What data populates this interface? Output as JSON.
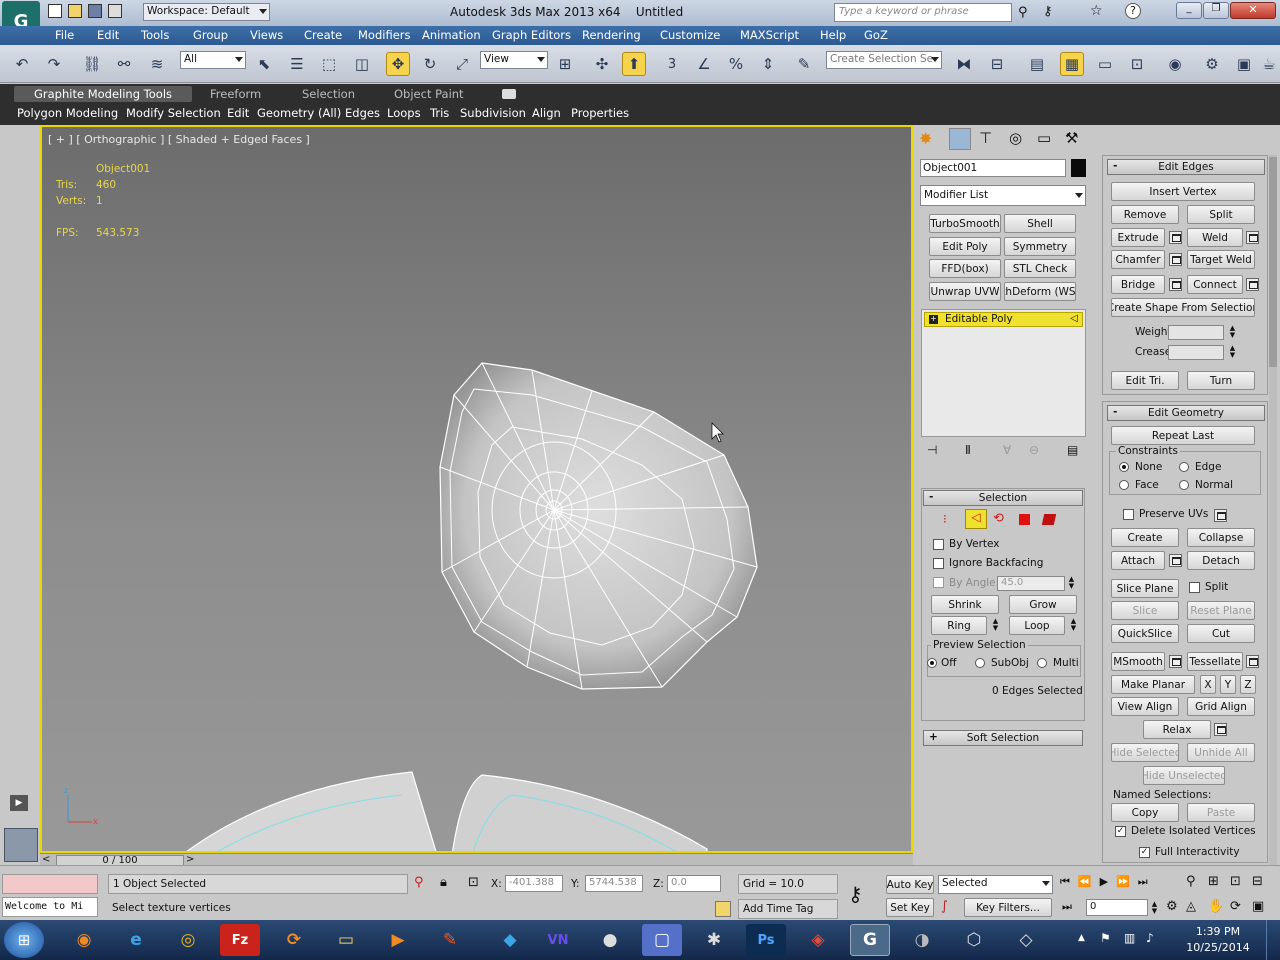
{
  "title": {
    "app": "Autodesk 3ds Max 2013 x64",
    "file": "Untitled",
    "workspace": "Workspace: Default",
    "search_placeholder": "Type a keyword or phrase"
  },
  "menu": [
    "File",
    "Edit",
    "Tools",
    "Group",
    "Views",
    "Create",
    "Modifiers",
    "Animation",
    "Graph Editors",
    "Rendering",
    "Customize",
    "MAXScript",
    "Help",
    "GoZ"
  ],
  "toolbar": {
    "filter": "All",
    "ref_coord": "View",
    "snap_label": "3",
    "selection_set_placeholder": "Create Selection Se"
  },
  "ribbon": {
    "tabs": [
      "Graphite Modeling Tools",
      "Freeform",
      "Selection",
      "Object Paint"
    ],
    "subtabs": [
      "Polygon Modeling",
      "Modify Selection",
      "Edit",
      "Geometry (All)",
      "Edges",
      "Loops",
      "Tris",
      "Subdivision",
      "Align",
      "Properties"
    ]
  },
  "viewport": {
    "label": "[ + ] [ Orthographic ] [ Shaded + Edged Faces ]",
    "object": "Object001",
    "tris_label": "Tris:",
    "tris": "460",
    "verts_label": "Verts:",
    "verts": "1",
    "fps_label": "FPS:",
    "fps": "543.573"
  },
  "modify": {
    "object_name": "Object001",
    "modifier_list": "Modifier List",
    "modifier_buttons": [
      "TurboSmooth",
      "Shell",
      "Edit Poly",
      "Symmetry",
      "FFD(box)",
      "STL Check",
      "Unwrap UVW",
      "thDeform (WSI"
    ],
    "stack_item": "Editable Poly",
    "selection": {
      "header": "Selection",
      "by_vertex": "By Vertex",
      "ignore_backfacing": "Ignore Backfacing",
      "by_angle": "By Angle:",
      "angle_value": "45.0",
      "shrink": "Shrink",
      "grow": "Grow",
      "ring": "Ring",
      "loop": "Loop",
      "preview_label": "Preview Selection",
      "preview_off": "Off",
      "preview_subobj": "SubObj",
      "preview_multi": "Multi",
      "selected_count": "0 Edges Selected"
    },
    "soft_selection": "Soft Selection"
  },
  "edit_edges": {
    "header": "Edit Edges",
    "insert_vertex": "Insert Vertex",
    "remove": "Remove",
    "split": "Split",
    "extrude": "Extrude",
    "weld": "Weld",
    "chamfer": "Chamfer",
    "target_weld": "Target Weld",
    "bridge": "Bridge",
    "connect": "Connect",
    "create_shape": "Create Shape From Selection",
    "weight": "Weight:",
    "crease": "Crease:",
    "edit_tri": "Edit Tri.",
    "turn": "Turn"
  },
  "edit_geometry": {
    "header": "Edit Geometry",
    "repeat_last": "Repeat Last",
    "constraints": "Constraints",
    "none": "None",
    "edge": "Edge",
    "face": "Face",
    "normal": "Normal",
    "preserve_uvs": "Preserve UVs",
    "create": "Create",
    "collapse": "Collapse",
    "attach": "Attach",
    "detach": "Detach",
    "slice_plane": "Slice Plane",
    "split": "Split",
    "slice": "Slice",
    "reset_plane": "Reset Plane",
    "quickslice": "QuickSlice",
    "cut": "Cut",
    "msmooth": "MSmooth",
    "tessellate": "Tessellate",
    "make_planar": "Make Planar",
    "x": "X",
    "y": "Y",
    "z": "Z",
    "view_align": "View Align",
    "grid_align": "Grid Align",
    "relax": "Relax",
    "hide_selected": "Hide Selected",
    "unhide_all": "Unhide All",
    "hide_unselected": "Hide Unselected",
    "named_selections": "Named Selections:",
    "copy": "Copy",
    "paste": "Paste",
    "delete_isolated": "Delete Isolated Vertices",
    "full_interactivity": "Full Interactivity"
  },
  "timeline": {
    "frame": "0 / 100"
  },
  "status": {
    "listener": "Welcome to Mi",
    "selected": "1 Object Selected",
    "prompt": "Select texture vertices",
    "x_label": "X:",
    "x": "-401.388",
    "y_label": "Y:",
    "y": "5744.538",
    "z_label": "Z:",
    "z": "0.0",
    "grid": "Grid = 10.0",
    "add_time_tag": "Add Time Tag",
    "auto_key": "Auto Key",
    "set_key": "Set Key",
    "key_mode": "Selected",
    "key_filters": "Key Filters...",
    "frame_field": "0"
  },
  "clock": {
    "time": "1:39 PM",
    "date": "10/25/2014"
  },
  "colors": {
    "viewport_border": "#e8d800",
    "stack_highlight": "#f0e030",
    "wire": "#ffffff"
  }
}
